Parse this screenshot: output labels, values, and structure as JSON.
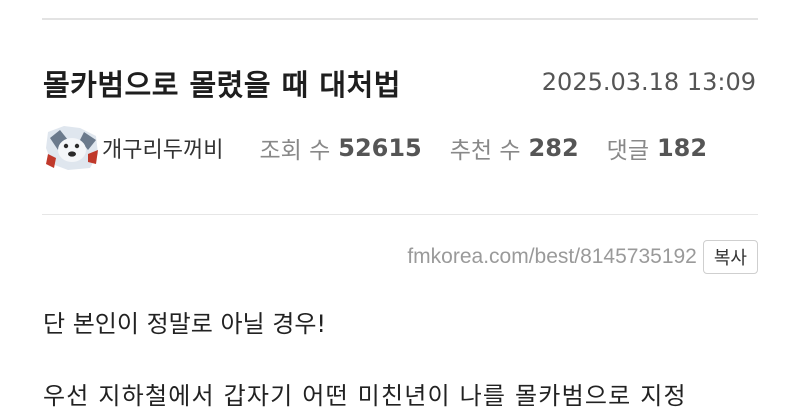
{
  "post": {
    "title": "몰카범으로 몰렸을 때 대처법",
    "date": "2025.03.18 13:09",
    "author": "개구리두꺼비",
    "views_label": "조회 수",
    "views": "52615",
    "recommend_label": "추천 수",
    "recommend": "282",
    "comments_label": "댓글",
    "comments": "182",
    "url": "fmkorea.com/best/8145735192",
    "copy_label": "복사"
  },
  "content": {
    "lines": [
      "단 본인이 정말로 아닐 경우!",
      "우선 지하철에서 갑자기 어떤 미친년이 나를 몰카범으로 지정"
    ]
  },
  "icons": {
    "avatar": "polar-bear-avatar"
  },
  "colors": {
    "text": "#222222",
    "muted": "#888888",
    "divider": "#e3e3e3"
  }
}
